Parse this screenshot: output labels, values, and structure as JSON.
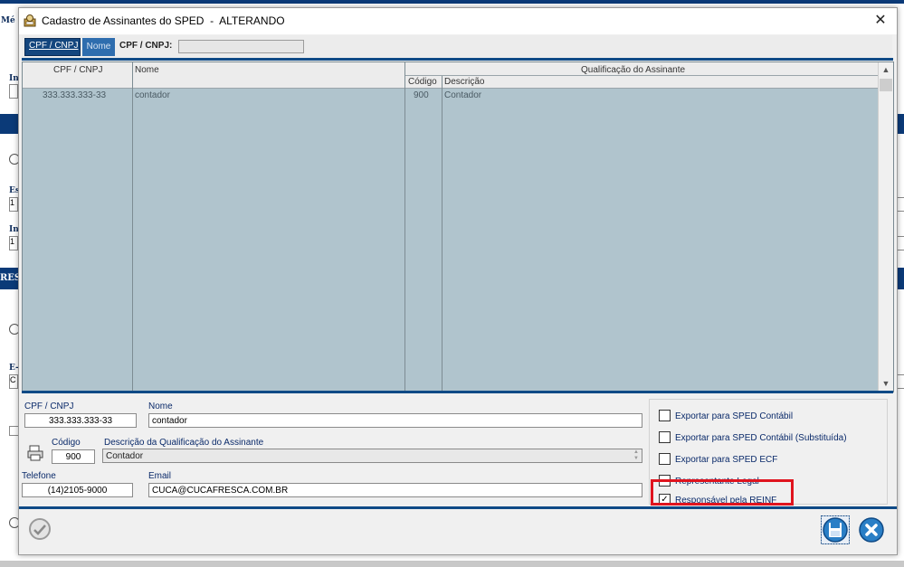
{
  "background": {
    "fragments": [
      "Mé",
      "In",
      "Es",
      "In",
      "RES",
      "E-",
      "1",
      "1",
      "C"
    ]
  },
  "dialog": {
    "title": "Cadastro de Assinantes do SPED  -  ALTERANDO",
    "close_symbol": "✕"
  },
  "search": {
    "tab_cpf": "CPF / CNPJ",
    "tab_nome": "Nome",
    "label": "CPF / CNPJ:",
    "value": ""
  },
  "grid": {
    "columns": {
      "cpf": "CPF / CNPJ",
      "nome": "Nome",
      "group": "Qualificação do Assinante",
      "codigo": "Código",
      "descricao": "Descrição"
    },
    "rows": [
      {
        "cpf": "333.333.333-33",
        "nome": "contador",
        "codigo": "900",
        "descricao": "Contador"
      }
    ]
  },
  "form": {
    "cpf_label": "CPF / CNPJ",
    "cpf_value": "333.333.333-33",
    "nome_label": "Nome",
    "nome_value": "contador",
    "codigo_label": "Código",
    "codigo_value": "900",
    "descricao_label": "Descrição da Qualificação do Assinante",
    "descricao_value": "Contador",
    "telefone_label": "Telefone",
    "telefone_value": "(14)2105-9000",
    "email_label": "Email",
    "email_value": "CUCA@CUCAFRESCA.COM.BR"
  },
  "checkboxes": [
    {
      "label": "Exportar para SPED Contábil",
      "checked": false
    },
    {
      "label": "Exportar para SPED Contábil (Substituída)",
      "checked": false
    },
    {
      "label": "Exportar para SPED ECF",
      "checked": false
    },
    {
      "label": "Representante Legal",
      "checked": false
    },
    {
      "label": "Responsável pela REINF",
      "checked": true
    }
  ],
  "colors": {
    "accent": "#0f4a86",
    "grid_bg": "#b0c4cd",
    "highlight": "#e0141e"
  },
  "icons": [
    "printer-icon",
    "help-icon",
    "save-icon",
    "cancel-icon",
    "close-icon",
    "app-icon"
  ]
}
